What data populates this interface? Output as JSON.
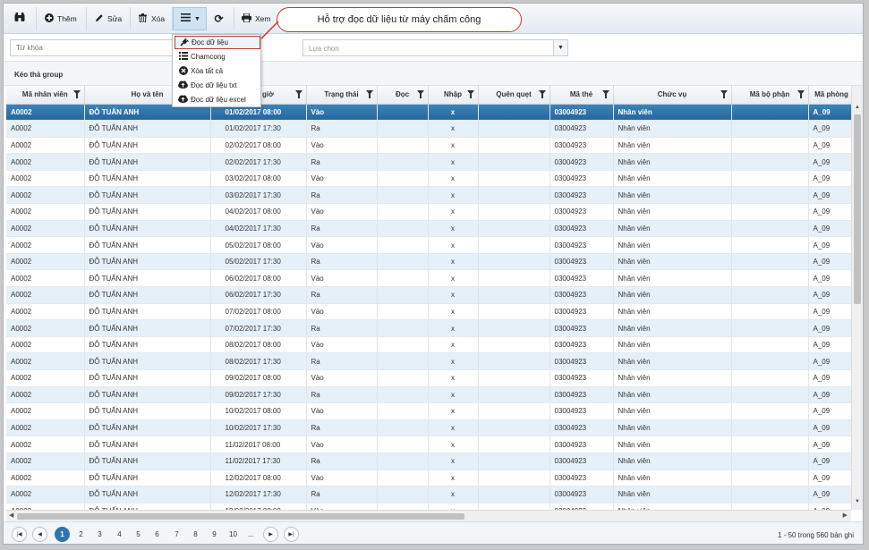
{
  "toolbar": {
    "add_label": "Thêm",
    "edit_label": "Sửa",
    "delete_label": "Xóa",
    "view_label": "Xem"
  },
  "callout": "Hỗ trợ đọc dữ liệu từ máy chấm công",
  "menu": {
    "items": [
      {
        "label": "Đọc dữ liệu",
        "icon": "plug-icon"
      },
      {
        "label": "Chamcong",
        "icon": "list-icon"
      },
      {
        "label": "Xóa tất cả",
        "icon": "clear-icon"
      },
      {
        "label": "Đọc dữ liệu txt",
        "icon": "cloud-upload-icon"
      },
      {
        "label": "Đọc dữ liệu excel",
        "icon": "cloud-upload-icon"
      }
    ]
  },
  "filter": {
    "keyword_placeholder": "Từ khóa",
    "select_placeholder": "Lựa chọn"
  },
  "group_label": "Kéo thả group",
  "columns": [
    "Mã nhân viên",
    "Họ và tên",
    "Ngày giờ",
    "Trạng thái",
    "Đọc",
    "Nhập",
    "Quên quẹt",
    "Mã thẻ",
    "Chức vụ",
    "Mã bộ phận",
    "Mã phòng"
  ],
  "rows": [
    [
      "A0002",
      "ĐỖ TUẤN ANH",
      "01/02/2017 08:00",
      "Vào",
      "",
      "x",
      "",
      "03004923",
      "Nhân viên",
      "",
      "A_09"
    ],
    [
      "A0002",
      "ĐỖ TUẤN ANH",
      "01/02/2017 17:30",
      "Ra",
      "",
      "x",
      "",
      "03004923",
      "Nhân viên",
      "",
      "A_09"
    ],
    [
      "A0002",
      "ĐỖ TUẤN ANH",
      "02/02/2017 08:00",
      "Vào",
      "",
      "x",
      "",
      "03004923",
      "Nhân viên",
      "",
      "A_09"
    ],
    [
      "A0002",
      "ĐỖ TUẤN ANH",
      "02/02/2017 17:30",
      "Ra",
      "",
      "x",
      "",
      "03004923",
      "Nhân viên",
      "",
      "A_09"
    ],
    [
      "A0002",
      "ĐỖ TUẤN ANH",
      "03/02/2017 08:00",
      "Vào",
      "",
      "x",
      "",
      "03004923",
      "Nhân viên",
      "",
      "A_09"
    ],
    [
      "A0002",
      "ĐỖ TUẤN ANH",
      "03/02/2017 17:30",
      "Ra",
      "",
      "x",
      "",
      "03004923",
      "Nhân viên",
      "",
      "A_09"
    ],
    [
      "A0002",
      "ĐỖ TUẤN ANH",
      "04/02/2017 08:00",
      "Vào",
      "",
      "x",
      "",
      "03004923",
      "Nhân viên",
      "",
      "A_09"
    ],
    [
      "A0002",
      "ĐỖ TUẤN ANH",
      "04/02/2017 17:30",
      "Ra",
      "",
      "x",
      "",
      "03004923",
      "Nhân viên",
      "",
      "A_09"
    ],
    [
      "A0002",
      "ĐỖ TUẤN ANH",
      "05/02/2017 08:00",
      "Vào",
      "",
      "x",
      "",
      "03004923",
      "Nhân viên",
      "",
      "A_09"
    ],
    [
      "A0002",
      "ĐỖ TUẤN ANH",
      "05/02/2017 17:30",
      "Ra",
      "",
      "x",
      "",
      "03004923",
      "Nhân viên",
      "",
      "A_09"
    ],
    [
      "A0002",
      "ĐỖ TUẤN ANH",
      "06/02/2017 08:00",
      "Vào",
      "",
      "x",
      "",
      "03004923",
      "Nhân viên",
      "",
      "A_09"
    ],
    [
      "A0002",
      "ĐỖ TUẤN ANH",
      "06/02/2017 17:30",
      "Ra",
      "",
      "x",
      "",
      "03004923",
      "Nhân viên",
      "",
      "A_09"
    ],
    [
      "A0002",
      "ĐỖ TUẤN ANH",
      "07/02/2017 08:00",
      "Vào",
      "",
      "x",
      "",
      "03004923",
      "Nhân viên",
      "",
      "A_09"
    ],
    [
      "A0002",
      "ĐỖ TUẤN ANH",
      "07/02/2017 17:30",
      "Ra",
      "",
      "x",
      "",
      "03004923",
      "Nhân viên",
      "",
      "A_09"
    ],
    [
      "A0002",
      "ĐỖ TUẤN ANH",
      "08/02/2017 08:00",
      "Vào",
      "",
      "x",
      "",
      "03004923",
      "Nhân viên",
      "",
      "A_09"
    ],
    [
      "A0002",
      "ĐỖ TUẤN ANH",
      "08/02/2017 17:30",
      "Ra",
      "",
      "x",
      "",
      "03004923",
      "Nhân viên",
      "",
      "A_09"
    ],
    [
      "A0002",
      "ĐỖ TUẤN ANH",
      "09/02/2017 08:00",
      "Vào",
      "",
      "x",
      "",
      "03004923",
      "Nhân viên",
      "",
      "A_09"
    ],
    [
      "A0002",
      "ĐỖ TUẤN ANH",
      "09/02/2017 17:30",
      "Ra",
      "",
      "x",
      "",
      "03004923",
      "Nhân viên",
      "",
      "A_09"
    ],
    [
      "A0002",
      "ĐỖ TUẤN ANH",
      "10/02/2017 08:00",
      "Vào",
      "",
      "x",
      "",
      "03004923",
      "Nhân viên",
      "",
      "A_09"
    ],
    [
      "A0002",
      "ĐỖ TUẤN ANH",
      "10/02/2017 17:30",
      "Ra",
      "",
      "x",
      "",
      "03004923",
      "Nhân viên",
      "",
      "A_09"
    ],
    [
      "A0002",
      "ĐỖ TUẤN ANH",
      "11/02/2017 08:00",
      "Vào",
      "",
      "x",
      "",
      "03004923",
      "Nhân viên",
      "",
      "A_09"
    ],
    [
      "A0002",
      "ĐỖ TUẤN ANH",
      "11/02/2017 17:30",
      "Ra",
      "",
      "x",
      "",
      "03004923",
      "Nhân viên",
      "",
      "A_09"
    ],
    [
      "A0002",
      "ĐỖ TUẤN ANH",
      "12/02/2017 08:00",
      "Vào",
      "",
      "x",
      "",
      "03004923",
      "Nhân viên",
      "",
      "A_09"
    ],
    [
      "A0002",
      "ĐỖ TUẤN ANH",
      "12/02/2017 17:30",
      "Ra",
      "",
      "x",
      "",
      "03004923",
      "Nhân viên",
      "",
      "A_09"
    ],
    [
      "A0002",
      "ĐỖ TUẤN ANH",
      "13/02/2017 08:00",
      "Vào",
      "",
      "x",
      "",
      "03004923",
      "Nhân viên",
      "",
      "A_09"
    ]
  ],
  "pager": {
    "pages": [
      "1",
      "2",
      "3",
      "4",
      "5",
      "6",
      "7",
      "8",
      "9",
      "10",
      "..."
    ],
    "current": "1",
    "info": "1 - 50 trong 560 bản ghi"
  },
  "colors": {
    "selected_row": "#2f75ab",
    "alt_row": "#e6f0f8",
    "callout_border": "#c0392b"
  }
}
